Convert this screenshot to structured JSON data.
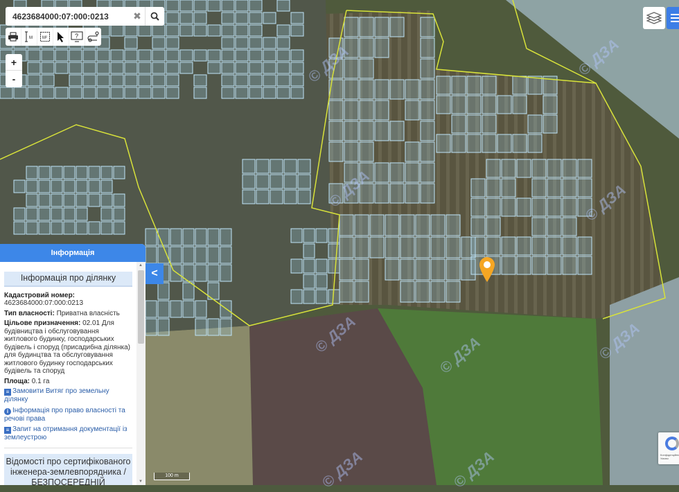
{
  "search": {
    "value": "4623684000:07:000:0213"
  },
  "toolbar": {
    "items": [
      {
        "name": "print-icon"
      },
      {
        "name": "measure-distance-icon",
        "label": "M"
      },
      {
        "name": "measure-area-icon",
        "label": "M²"
      },
      {
        "name": "pointer-icon"
      },
      {
        "name": "help-icon"
      },
      {
        "name": "route-icon"
      }
    ]
  },
  "zoom": {
    "in": "+",
    "out": "-"
  },
  "panel": {
    "title": "Інформація",
    "section_title": "Інформація про ділянку",
    "cadastral_label": "Кадастровий номер:",
    "cadastral_value": "4623684000:07:000:0213",
    "ownership_label": "Тип власності:",
    "ownership_value": "Приватна власність",
    "purpose_label": "Цільове призначення:",
    "purpose_value": "02.01 Для будівництва і обслуговування житлового будинку, господарських будівель і споруд (присадибна ділянка) для будинцтва та обслуговування житлового будинку господарських будівель та споруд",
    "area_label": "Площа:",
    "area_value": "0.1 га",
    "links": [
      "Замовити Витяг про земельну ділянку",
      "Інформація про право власності та речові права",
      "Запит на отримання документації із землеустрою"
    ],
    "engineer_section": "Відомості про сертифікованого інженера-землевпорядника / БЕЗПОСЕРЕДНІЙ ВИКОНАВЕЦЬ"
  },
  "collapse_label": "<",
  "scale_label": "100 m",
  "watermark": "© ДЗА",
  "recaptcha_text": "Конфіденційність - Умови",
  "colors": {
    "accent": "#3d87e8",
    "boundary": "#d8e23a",
    "parcel": "#9fd3f0",
    "pin": "#f5a623"
  }
}
